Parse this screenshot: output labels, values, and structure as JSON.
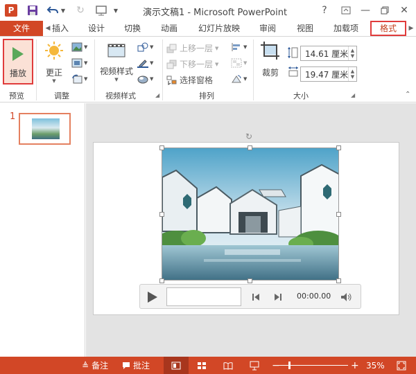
{
  "title_bar": {
    "app_icon_letter": "P",
    "title": "演示文稿1 - Microsoft PowerPoint",
    "help": "?"
  },
  "tabs": [
    {
      "label": "文件",
      "active": false
    },
    {
      "label": "插入"
    },
    {
      "label": "设计"
    },
    {
      "label": "切换"
    },
    {
      "label": "动画"
    },
    {
      "label": "幻灯片放映"
    },
    {
      "label": "审阅"
    },
    {
      "label": "视图"
    },
    {
      "label": "加载项"
    },
    {
      "label": "格式",
      "active": true
    }
  ],
  "ribbon": {
    "preview": {
      "play_label": "播放",
      "group_label": "预览"
    },
    "adjust": {
      "correct_label": "更正",
      "group_label": "调整"
    },
    "video_styles": {
      "styles_label": "视频样式",
      "group_label": "视频样式"
    },
    "arrange": {
      "bring_forward": "上移一层",
      "send_backward": "下移一层",
      "selection_pane": "选择窗格",
      "group_label": "排列"
    },
    "size": {
      "crop_label": "裁剪",
      "height_value": "14.61 厘米",
      "width_value": "19.47 厘米",
      "group_label": "大小"
    }
  },
  "thumbnail": {
    "slide_number": "1"
  },
  "player": {
    "time": "00:00.00"
  },
  "status_bar": {
    "notes": "备注",
    "comments": "批注",
    "zoom": "35%"
  },
  "colors": {
    "accent": "#d24726",
    "highlight_box": "#e03b3b",
    "play_green": "#5aa85a"
  }
}
